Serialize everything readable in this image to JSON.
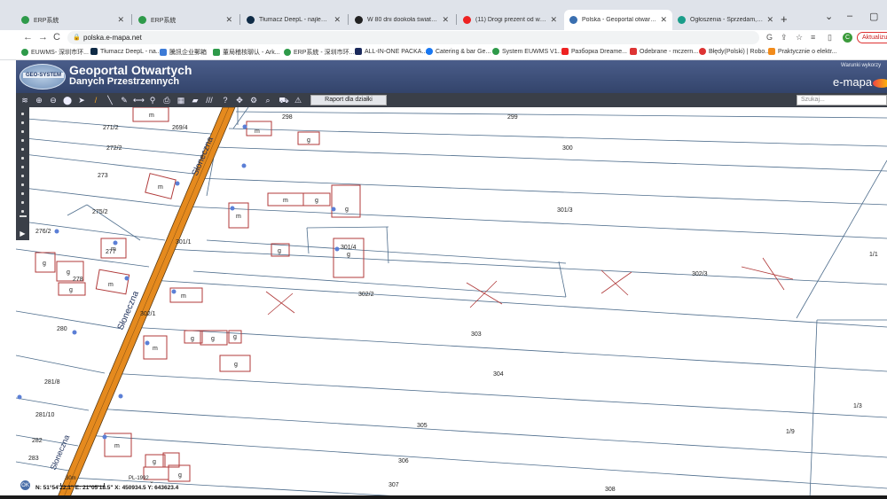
{
  "browser": {
    "tabs": [
      {
        "title": "ERP系統",
        "fav": "#2e9a4a"
      },
      {
        "title": "ERP系統",
        "fav": "#2e9a4a"
      },
      {
        "title": "Tłumacz DeepL - najlepszy tran...",
        "fav": "#0f2b46"
      },
      {
        "title": "W 80 dni dookoła świata | Ogła...",
        "fav": "#222"
      },
      {
        "title": "(11) Drogi prezent od widz...",
        "fav": "#e22"
      },
      {
        "title": "Polska - Geoportal otwartych d...",
        "fav": "#3a6fb0"
      },
      {
        "title": "Ogłoszenia - Sprzedam, kupię ...",
        "fav": "#1a9d8a"
      }
    ],
    "new_tab": "+",
    "window_controls": [
      "⌄",
      "–",
      "▢"
    ],
    "nav": {
      "back": "←",
      "forward": "→",
      "reload": "C"
    },
    "url": "polska.e-mapa.net",
    "avatar_letter": "C",
    "update_button": "Aktualizuj",
    "bookmarks": [
      {
        "label": "EUWMS- 深圳市环...",
        "color": "#2e9a4a"
      },
      {
        "label": "Tłumacz DeepL - na...",
        "color": "#0f2b46"
      },
      {
        "label": "騰訊企业郵箱",
        "color": "#3d7bd6"
      },
      {
        "label": "董局稽核聊认 - Ark...",
        "color": "#2e9a4a"
      },
      {
        "label": "ERP系統 - 深圳市环...",
        "color": "#2e9a4a"
      },
      {
        "label": "ALL-IN-ONE PACKA...",
        "color": "#1b2a5c"
      },
      {
        "label": "Catering & bar Ge...",
        "color": "#1877f2"
      },
      {
        "label": "System EUWMS V1...",
        "color": "#2e9a4a"
      },
      {
        "label": "Разборка Dreame...",
        "color": "#e22"
      },
      {
        "label": "Odebrane - mczern...",
        "color": "#d33"
      },
      {
        "label": "Błędy(Polski) | Robo...",
        "color": "#d33"
      },
      {
        "label": "Praktycznie o elektr...",
        "color": "#f28b1a"
      }
    ]
  },
  "geoportal": {
    "logo_text": "GEO-SYSTEM",
    "title_line1": "Geoportal Otwartych",
    "title_line2": "Danych Przestrzennych",
    "terms": "Warunki wykorzy",
    "brand": "e-mapa",
    "report_button": "Raport dla działki",
    "search_placeholder": "Szukaj...",
    "toolbar_icons": [
      "layers-icon",
      "zoom-in-icon",
      "zoom-out-icon",
      "full-extent-icon",
      "pointer-icon",
      "pencil-icon",
      "measure-line-icon",
      "measure-tool-icon",
      "width-icon",
      "pin-icon",
      "print-icon",
      "table-icon",
      "speech-icon",
      "lines-icon",
      "help-icon",
      "move-icon",
      "find-icon",
      "search-map-icon",
      "cart-icon",
      "warning-icon"
    ]
  },
  "map": {
    "street_name": "Słoneczna",
    "parcels": [
      "298",
      "299",
      "269/4",
      "271/2",
      "272/2",
      "300",
      "273",
      "275/2",
      "301/3",
      "276/2",
      "277",
      "301/1",
      "301/4",
      "1/1",
      "278",
      "302/3",
      "302/2",
      "302/1",
      "280",
      "303",
      "304",
      "281/8",
      "1/3",
      "281/10",
      "305",
      "1/9",
      "282",
      "283",
      "306",
      "307",
      "308"
    ],
    "building_marks": [
      "m",
      "g"
    ]
  },
  "status": {
    "ok": "OK",
    "scale": "30m",
    "crs": "PL-1992",
    "coords": "N: 51°54'22.1\"  E: 21°05'18.5\"  X: 450934.5  Y: 643623.4"
  }
}
